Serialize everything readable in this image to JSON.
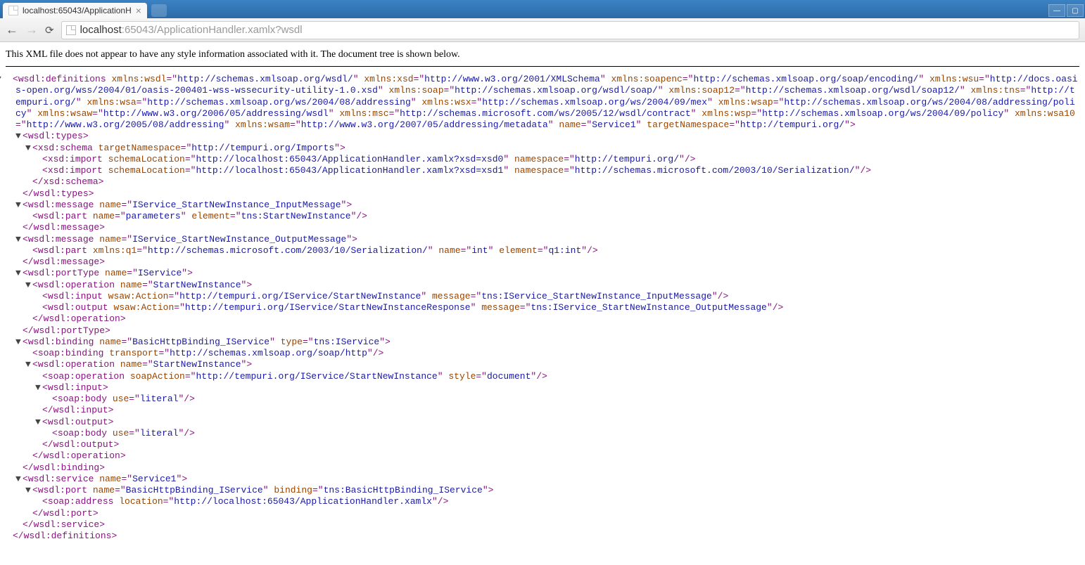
{
  "browser": {
    "tab_title": "localhost:65043/ApplicationH",
    "url_host": "localhost",
    "url_path": ":65043/ApplicationHandler.xamlx?wsdl"
  },
  "info_message": "This XML file does not appear to have any style information associated with it. The document tree is shown below.",
  "xml": {
    "root_tag": "wsdl:definitions",
    "root_attrs": [
      {
        "n": "xmlns:wsdl",
        "v": "http://schemas.xmlsoap.org/wsdl/"
      },
      {
        "n": "xmlns:xsd",
        "v": "http://www.w3.org/2001/XMLSchema"
      },
      {
        "n": "xmlns:soapenc",
        "v": "http://schemas.xmlsoap.org/soap/encoding/"
      },
      {
        "n": "xmlns:wsu",
        "v": "http://docs.oasis-open.org/wss/2004/01/oasis-200401-wss-wssecurity-utility-1.0.xsd"
      },
      {
        "n": "xmlns:soap",
        "v": "http://schemas.xmlsoap.org/wsdl/soap/"
      },
      {
        "n": "xmlns:soap12",
        "v": "http://schemas.xmlsoap.org/wsdl/soap12/"
      },
      {
        "n": "xmlns:tns",
        "v": "http://tempuri.org/"
      },
      {
        "n": "xmlns:wsa",
        "v": "http://schemas.xmlsoap.org/ws/2004/08/addressing"
      },
      {
        "n": "xmlns:wsx",
        "v": "http://schemas.xmlsoap.org/ws/2004/09/mex"
      },
      {
        "n": "xmlns:wsap",
        "v": "http://schemas.xmlsoap.org/ws/2004/08/addressing/policy"
      },
      {
        "n": "xmlns:wsaw",
        "v": "http://www.w3.org/2006/05/addressing/wsdl"
      },
      {
        "n": "xmlns:msc",
        "v": "http://schemas.microsoft.com/ws/2005/12/wsdl/contract"
      },
      {
        "n": "xmlns:wsp",
        "v": "http://schemas.xmlsoap.org/ws/2004/09/policy"
      },
      {
        "n": "xmlns:wsa10",
        "v": "http://www.w3.org/2005/08/addressing"
      },
      {
        "n": "xmlns:wsam",
        "v": "http://www.w3.org/2007/05/addressing/metadata"
      },
      {
        "n": "name",
        "v": "Service1"
      },
      {
        "n": "targetNamespace",
        "v": "http://tempuri.org/"
      }
    ],
    "types": {
      "tag": "wsdl:types",
      "schema_tag": "xsd:schema",
      "schema_attrs": [
        {
          "n": "targetNamespace",
          "v": "http://tempuri.org/Imports"
        }
      ],
      "imports": [
        {
          "tag": "xsd:import",
          "attrs": [
            {
              "n": "schemaLocation",
              "v": "http://localhost:65043/ApplicationHandler.xamlx?xsd=xsd0"
            },
            {
              "n": "namespace",
              "v": "http://tempuri.org/"
            }
          ]
        },
        {
          "tag": "xsd:import",
          "attrs": [
            {
              "n": "schemaLocation",
              "v": "http://localhost:65043/ApplicationHandler.xamlx?xsd=xsd1"
            },
            {
              "n": "namespace",
              "v": "http://schemas.microsoft.com/2003/10/Serialization/"
            }
          ]
        }
      ]
    },
    "messages": [
      {
        "tag": "wsdl:message",
        "attrs": [
          {
            "n": "name",
            "v": "IService_StartNewInstance_InputMessage"
          }
        ],
        "part": {
          "tag": "wsdl:part",
          "attrs": [
            {
              "n": "name",
              "v": "parameters"
            },
            {
              "n": "element",
              "v": "tns:StartNewInstance"
            }
          ]
        }
      },
      {
        "tag": "wsdl:message",
        "attrs": [
          {
            "n": "name",
            "v": "IService_StartNewInstance_OutputMessage"
          }
        ],
        "part": {
          "tag": "wsdl:part",
          "attrs": [
            {
              "n": "xmlns:q1",
              "v": "http://schemas.microsoft.com/2003/10/Serialization/"
            },
            {
              "n": "name",
              "v": "int"
            },
            {
              "n": "element",
              "v": "q1:int"
            }
          ]
        }
      }
    ],
    "portType": {
      "tag": "wsdl:portType",
      "attrs": [
        {
          "n": "name",
          "v": "IService"
        }
      ],
      "operation": {
        "tag": "wsdl:operation",
        "attrs": [
          {
            "n": "name",
            "v": "StartNewInstance"
          }
        ],
        "input": {
          "tag": "wsdl:input",
          "attrs": [
            {
              "n": "wsaw:Action",
              "v": "http://tempuri.org/IService/StartNewInstance"
            },
            {
              "n": "message",
              "v": "tns:IService_StartNewInstance_InputMessage"
            }
          ]
        },
        "output": {
          "tag": "wsdl:output",
          "attrs": [
            {
              "n": "wsaw:Action",
              "v": "http://tempuri.org/IService/StartNewInstanceResponse"
            },
            {
              "n": "message",
              "v": "tns:IService_StartNewInstance_OutputMessage"
            }
          ]
        }
      }
    },
    "binding": {
      "tag": "wsdl:binding",
      "attrs": [
        {
          "n": "name",
          "v": "BasicHttpBinding_IService"
        },
        {
          "n": "type",
          "v": "tns:IService"
        }
      ],
      "soapBinding": {
        "tag": "soap:binding",
        "attrs": [
          {
            "n": "transport",
            "v": "http://schemas.xmlsoap.org/soap/http"
          }
        ]
      },
      "operation": {
        "tag": "wsdl:operation",
        "attrs": [
          {
            "n": "name",
            "v": "StartNewInstance"
          }
        ],
        "soapOperation": {
          "tag": "soap:operation",
          "attrs": [
            {
              "n": "soapAction",
              "v": "http://tempuri.org/IService/StartNewInstance"
            },
            {
              "n": "style",
              "v": "document"
            }
          ]
        },
        "input": {
          "tag": "wsdl:input",
          "body": {
            "tag": "soap:body",
            "attrs": [
              {
                "n": "use",
                "v": "literal"
              }
            ]
          }
        },
        "output": {
          "tag": "wsdl:output",
          "body": {
            "tag": "soap:body",
            "attrs": [
              {
                "n": "use",
                "v": "literal"
              }
            ]
          }
        }
      }
    },
    "service": {
      "tag": "wsdl:service",
      "attrs": [
        {
          "n": "name",
          "v": "Service1"
        }
      ],
      "port": {
        "tag": "wsdl:port",
        "attrs": [
          {
            "n": "name",
            "v": "BasicHttpBinding_IService"
          },
          {
            "n": "binding",
            "v": "tns:BasicHttpBinding_IService"
          }
        ],
        "address": {
          "tag": "soap:address",
          "attrs": [
            {
              "n": "location",
              "v": "http://localhost:65043/ApplicationHandler.xamlx"
            }
          ]
        }
      }
    }
  }
}
